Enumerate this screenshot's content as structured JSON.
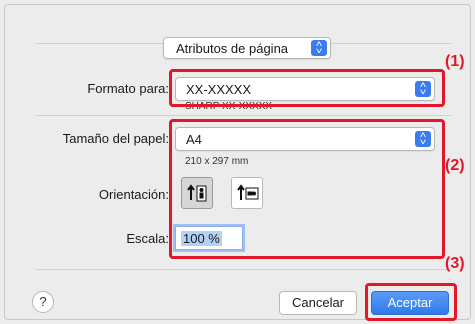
{
  "dialog": {
    "attributes_popup": "Atributos de página",
    "format_for": {
      "label": "Formato para:",
      "value": "XX-XXXXX",
      "subtitle": "SHARP XX-XXXXX"
    },
    "paper_size": {
      "label": "Tamaño del papel:",
      "value": "A4",
      "dimensions": "210 x 297 mm"
    },
    "orientation": {
      "label": "Orientación:",
      "selected": "portrait"
    },
    "scale": {
      "label": "Escala:",
      "value": "100 %"
    },
    "help_label": "?",
    "cancel_label": "Cancelar",
    "accept_label": "Aceptar"
  },
  "callouts": [
    "(1)",
    "(2)",
    "(3)"
  ],
  "colors": {
    "accent": "#3a7bf0",
    "highlight": "#e0182c"
  }
}
